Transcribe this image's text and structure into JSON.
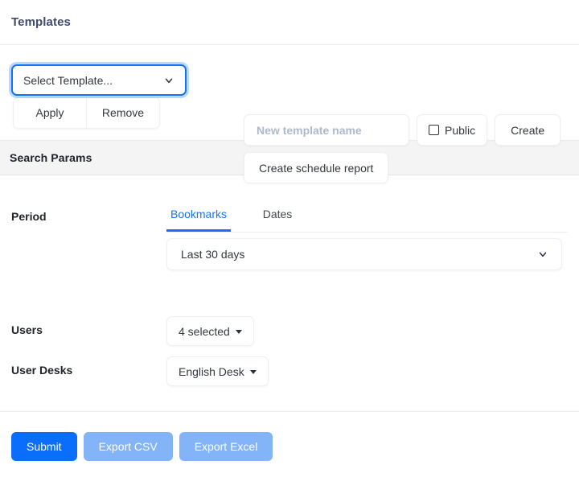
{
  "templates": {
    "title": "Templates",
    "select_template": {
      "value": "Select Template...",
      "icon": "chevron-down-icon"
    },
    "apply_label": "Apply",
    "remove_label": "Remove",
    "new_template_input": {
      "value": "",
      "placeholder": "New template name"
    },
    "public_label": "Public",
    "public_checked": false,
    "create_label": "Create",
    "create_schedule_label": "Create schedule report"
  },
  "search_params": {
    "section_title": "Search Params",
    "period": {
      "label": "Period",
      "tabs": [
        {
          "label": "Bookmarks",
          "active": true
        },
        {
          "label": "Dates",
          "active": false
        }
      ],
      "selected_range": "Last 30 days",
      "range_icon": "chevron-down-icon"
    },
    "users": {
      "label": "Users",
      "value": "4 selected",
      "icon": "caret-down-icon"
    },
    "user_desks": {
      "label": "User Desks",
      "value": "English Desk",
      "icon": "caret-down-icon"
    }
  },
  "actions": {
    "submit_label": "Submit",
    "export_csv_label": "Export CSV",
    "export_excel_label": "Export Excel"
  },
  "colors": {
    "primary_blue": "#0a6efb",
    "soft_blue": "#82b4f7",
    "tab_active_blue": "#1a73f0",
    "title_navy": "#3f4b6e",
    "band_gray": "#f4f4f5",
    "placeholder_gray": "#adb9cd"
  }
}
